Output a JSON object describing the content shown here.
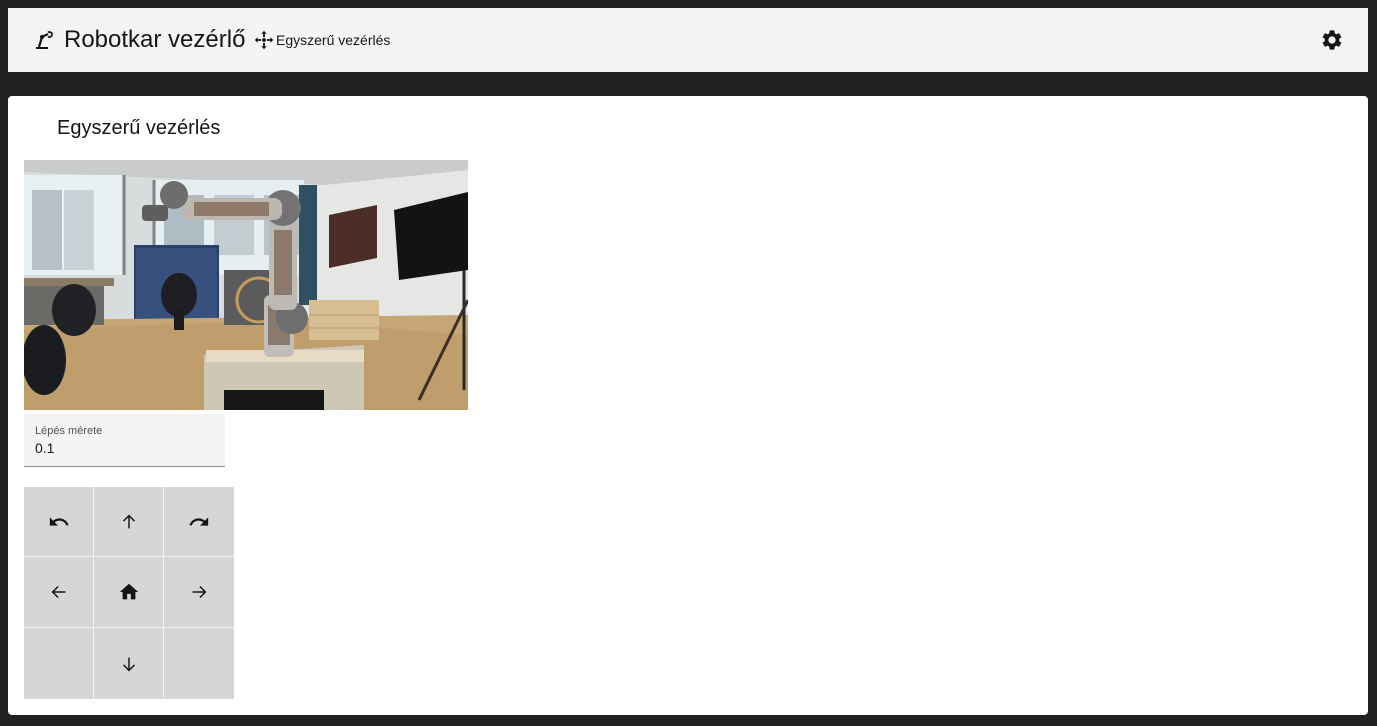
{
  "header": {
    "app_title": "Robotkar vezérlő",
    "brand_icon": "robot-arm-icon",
    "nav": {
      "label": "Egyszerű vezérlés",
      "icon": "move-arrows-icon"
    },
    "settings_icon": "gear-icon"
  },
  "main": {
    "panel_title": "Egyszerű vezérlés",
    "camera": {
      "description_icon": "camera-feed-image"
    },
    "step_size": {
      "label": "Lépés mérete",
      "value": "0.1"
    },
    "control_pad": [
      {
        "name": "rotate-left-button",
        "icon": "undo-icon"
      },
      {
        "name": "move-up-button",
        "icon": "arrow-up-icon"
      },
      {
        "name": "rotate-right-button",
        "icon": "redo-icon"
      },
      {
        "name": "move-left-button",
        "icon": "arrow-left-icon"
      },
      {
        "name": "home-button",
        "icon": "home-icon"
      },
      {
        "name": "move-right-button",
        "icon": "arrow-right-icon"
      },
      {
        "name": "empty-pad-cell",
        "icon": ""
      },
      {
        "name": "move-down-button",
        "icon": "arrow-down-icon"
      },
      {
        "name": "empty-pad-cell",
        "icon": ""
      }
    ]
  },
  "colors": {
    "background": "#212121",
    "header_bg": "#f4f4f4",
    "panel_bg": "#ffffff",
    "pad_button_bg": "#d6d6d6",
    "text": "#161616"
  }
}
